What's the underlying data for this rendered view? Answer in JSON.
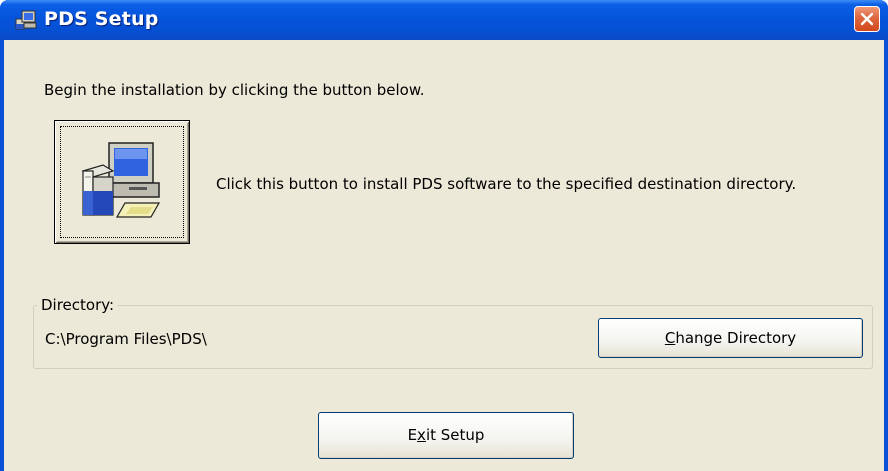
{
  "window": {
    "title": "PDS Setup",
    "title_icon": "setup-computer-icon",
    "close_icon": "close-icon"
  },
  "main": {
    "intro_text": "Begin the installation by clicking the button below.",
    "install_button_icon": "installer-computer-icon",
    "install_description": "Click this button to install PDS software to the specified destination directory."
  },
  "directory": {
    "group_label": "Directory:",
    "path": "C:\\Program Files\\PDS\\",
    "change_button": {
      "mnemonic": "C",
      "rest": "hange Directory"
    }
  },
  "footer": {
    "exit_button": {
      "before": "E",
      "mnemonic": "x",
      "after": "it Setup"
    }
  },
  "colors": {
    "titlebar": "#0654dc",
    "client_background": "#ece9d8",
    "close_button": "#d2471c",
    "button_border": "#003c74"
  }
}
